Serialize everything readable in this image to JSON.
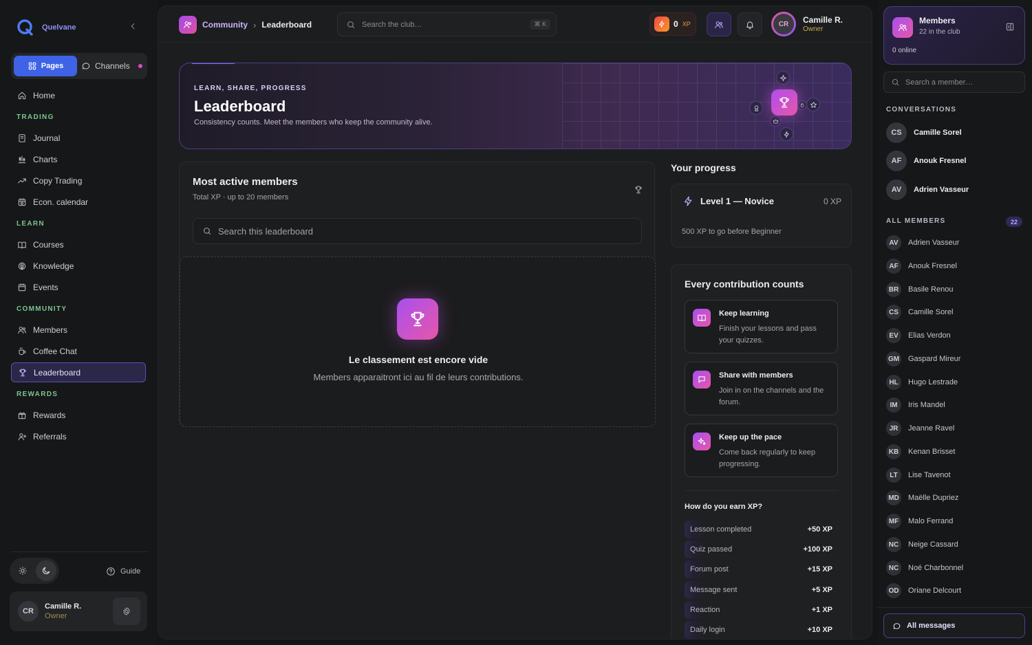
{
  "brand": {
    "name": "Quelvane"
  },
  "sidebar": {
    "switch": {
      "pages": "Pages",
      "channels": "Channels"
    },
    "home": "Home",
    "sections": {
      "trading": "TRADING",
      "learn": "LEARN",
      "community": "COMMUNITY",
      "rewards": "REWARDS"
    },
    "trading_items": [
      "Journal",
      "Charts",
      "Copy Trading",
      "Econ. calendar"
    ],
    "learn_items": [
      "Courses",
      "Knowledge",
      "Events"
    ],
    "community_items": [
      "Members",
      "Coffee Chat",
      "Leaderboard"
    ],
    "rewards_items": [
      "Rewards",
      "Referrals"
    ],
    "guide": "Guide",
    "user": {
      "initials": "CR",
      "name": "Camille R.",
      "role": "Owner"
    }
  },
  "topbar": {
    "breadcrumb": {
      "parent": "Community",
      "separator": "›",
      "current": "Leaderboard"
    },
    "search_placeholder": "Search the club…",
    "shortcut": "⌘ K",
    "xp": {
      "value": "0",
      "unit": "XP"
    },
    "user": {
      "initials": "CR",
      "name": "Camille R.",
      "role": "Owner"
    }
  },
  "hero": {
    "kicker": "LEARN, SHARE, PROGRESS",
    "title": "Leaderboard",
    "subtitle": "Consistency counts. Meet the members who keep the community alive."
  },
  "leaderboard": {
    "title": "Most active members",
    "subtitle": "Total XP · up to 20 members",
    "search_placeholder": "Search this leaderboard",
    "empty_title": "Le classement est encore vide",
    "empty_text": "Members apparaitront ici au fil de leurs contributions."
  },
  "progress": {
    "heading": "Your progress",
    "level": "Level 1 — Novice",
    "xp": "0 XP",
    "note": "500 XP to go before Beginner"
  },
  "contributions": {
    "title": "Every contribution counts",
    "cards": [
      {
        "title": "Keep learning",
        "desc": "Finish your lessons and pass your quizzes."
      },
      {
        "title": "Share with members",
        "desc": "Join in on the channels and the forum."
      },
      {
        "title": "Keep up the pace",
        "desc": "Come back regularly to keep progressing."
      }
    ],
    "earn_title": "How do you earn XP?",
    "earn_rows": [
      {
        "label": "Lesson completed",
        "value": "+50 XP"
      },
      {
        "label": "Quiz passed",
        "value": "+100 XP"
      },
      {
        "label": "Forum post",
        "value": "+15 XP"
      },
      {
        "label": "Message sent",
        "value": "+5 XP"
      },
      {
        "label": "Reaction",
        "value": "+1 XP"
      },
      {
        "label": "Daily login",
        "value": "+10 XP"
      }
    ]
  },
  "right_panel": {
    "members_title": "Members",
    "members_sub": "22 in the club",
    "online": "0 online",
    "search_placeholder": "Search a member…",
    "conversations_label": "CONVERSATIONS",
    "conversations": [
      {
        "initials": "CS",
        "name": "Camille Sorel"
      },
      {
        "initials": "AF",
        "name": "Anouk Fresnel"
      },
      {
        "initials": "AV",
        "name": "Adrien Vasseur"
      }
    ],
    "all_members_label": "ALL MEMBERS",
    "all_members_count": "22",
    "members": [
      {
        "initials": "AV",
        "name": "Adrien Vasseur"
      },
      {
        "initials": "AF",
        "name": "Anouk Fresnel"
      },
      {
        "initials": "BR",
        "name": "Basile Renou"
      },
      {
        "initials": "CS",
        "name": "Camille Sorel"
      },
      {
        "initials": "EV",
        "name": "Elias Verdon"
      },
      {
        "initials": "GM",
        "name": "Gaspard Mireur"
      },
      {
        "initials": "HL",
        "name": "Hugo Lestrade"
      },
      {
        "initials": "IM",
        "name": "Iris Mandel"
      },
      {
        "initials": "JR",
        "name": "Jeanne Ravel"
      },
      {
        "initials": "KB",
        "name": "Kenan Brisset"
      },
      {
        "initials": "LT",
        "name": "Lise Tavenot"
      },
      {
        "initials": "MD",
        "name": "Maëlle Dupriez"
      },
      {
        "initials": "MF",
        "name": "Malo Ferrand"
      },
      {
        "initials": "NC",
        "name": "Neige Cassard"
      },
      {
        "initials": "NC",
        "name": "Noé Charbonnel"
      },
      {
        "initials": "OD",
        "name": "Oriane Delcourt"
      }
    ],
    "all_messages": "All messages"
  },
  "colors": {
    "accent": "#3e63e6",
    "brand_gradient_start": "#a94ff0",
    "brand_gradient_end": "#e657a8",
    "section_label": "#7bc591",
    "active_border": "#5c50b5"
  }
}
